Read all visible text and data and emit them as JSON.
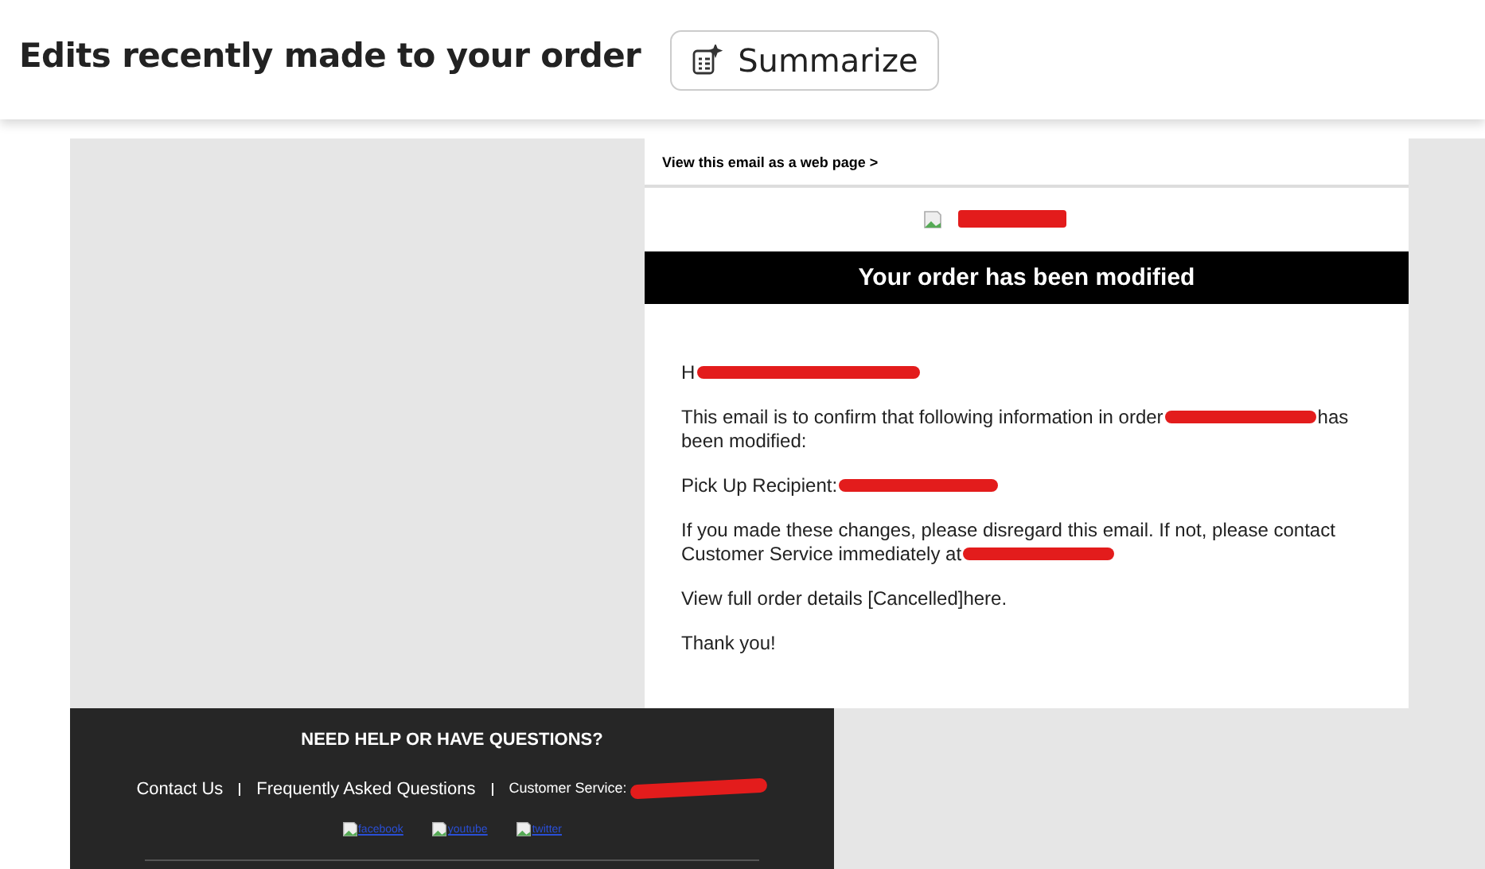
{
  "header": {
    "title": "Edits recently made to your order",
    "summarize_button": "Summarize"
  },
  "email": {
    "web_view_link": "View this email as a web page >",
    "banner": "Your order has been modified",
    "paragraphs": [
      [
        {
          "kind": "text",
          "text": "H"
        },
        {
          "kind": "redaction"
        }
      ],
      [
        {
          "kind": "text",
          "text": "This email is to confirm that following information in order"
        },
        {
          "kind": "redaction"
        },
        {
          "kind": "text",
          "text": "has"
        },
        {
          "kind": "break"
        },
        {
          "kind": "text",
          "text": "been modified:"
        }
      ],
      [
        {
          "kind": "text",
          "text": "Pick Up Recipient:"
        },
        {
          "kind": "redaction"
        }
      ],
      [
        {
          "kind": "text",
          "text": "If you made these changes, please disregard this email. If not, please contact"
        },
        {
          "kind": "break"
        },
        {
          "kind": "text",
          "text": "Customer Service immediately at"
        },
        {
          "kind": "redaction"
        }
      ],
      [
        {
          "kind": "text",
          "text": "View full order details [Cancelled]here."
        }
      ],
      [
        {
          "kind": "text",
          "text": "Thank you!"
        }
      ]
    ]
  },
  "footer": {
    "heading": "NEED HELP OR HAVE QUESTIONS?",
    "links": [
      {
        "kind": "link",
        "text": "Contact Us"
      },
      {
        "kind": "link",
        "text": "Frequently Asked Questions"
      },
      {
        "kind": "service",
        "text": "Customer Service: "
      }
    ],
    "social": [
      "facebook",
      "youtube",
      "twitter"
    ]
  }
}
